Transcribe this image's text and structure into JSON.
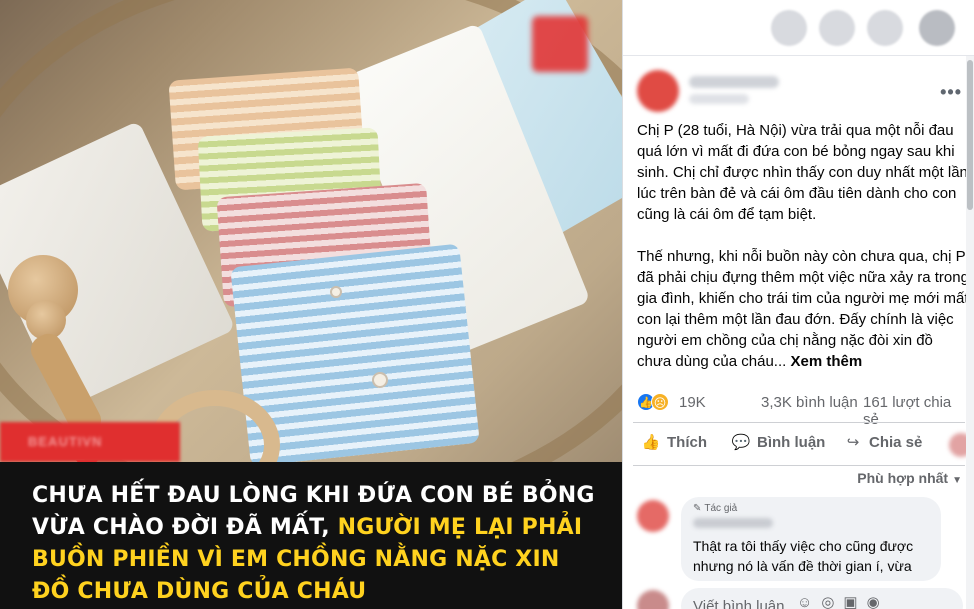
{
  "image": {
    "brand_badge": "BEAUTIVN",
    "headline_white": "Chưa hết đau lòng khi đứa con bé bỏng vừa chào đời đã mất,",
    "headline_yellow": "người mẹ lại phải buồn phiền vì em chồng nằng nặc xin đồ chưa dùng của cháu",
    "colors": {
      "headline_bg": "#111111",
      "highlight": "#ffd21f",
      "badge": "#e02f2f"
    }
  },
  "post": {
    "more_label": "•••",
    "paragraph1": "Chị P (28 tuổi, Hà Nội) vừa trải qua một nỗi đau quá lớn vì mất đi đứa con bé bỏng ngay sau khi sinh. Chị chỉ được nhìn thấy con duy nhất một lần lúc trên bàn đẻ và cái ôm đầu tiên dành cho con cũng là cái ôm để tạm biệt.",
    "paragraph2": "Thế nhưng, khi nỗi buồn này còn chưa qua, chị P đã phải chịu đựng thêm một việc nữa xảy ra trong gia đình, khiến cho trái tim của người mẹ mới mất con lại thêm một lần đau đớn. Đấy chính là việc người em chồng của chị nằng nặc đòi xin đồ chưa dùng của cháu...",
    "see_more": "Xem thêm"
  },
  "stats": {
    "reaction_icons": [
      "like-icon",
      "sad-icon"
    ],
    "reactions": "19K",
    "comments": "3,3K bình luận",
    "shares": "161 lượt chia sẻ"
  },
  "actions": {
    "like": "Thích",
    "comment": "Bình luận",
    "share": "Chia sẻ"
  },
  "comments": {
    "sort_label": "Phù hợp nhất",
    "first": {
      "badge": "Tác giả",
      "text": "Thật ra tôi thấy việc cho cũng được nhưng nó là vấn đề thời gian í, vừa"
    },
    "composer_placeholder": "Viết bình luận..."
  }
}
